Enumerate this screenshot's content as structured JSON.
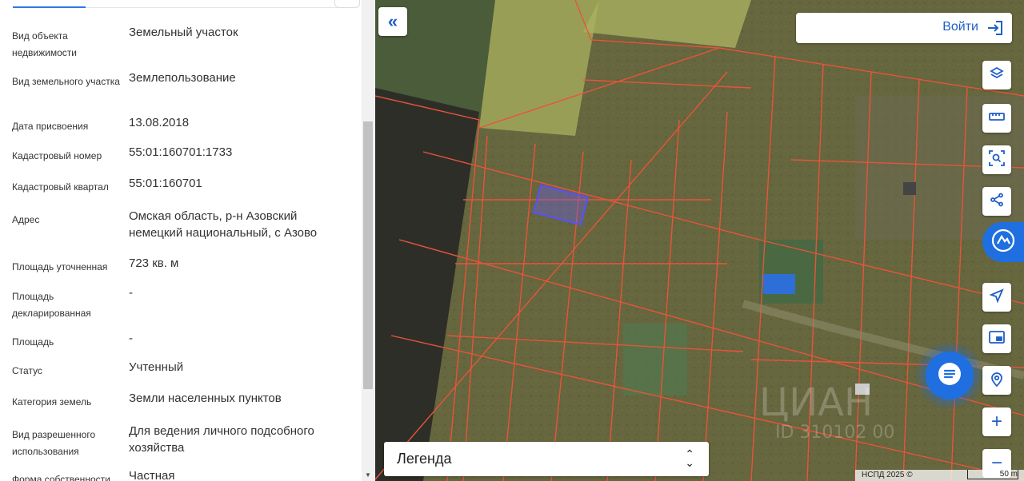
{
  "panel": {
    "rows": [
      {
        "label": "Вид объекта недвижимости",
        "value": "Земельный участок"
      },
      {
        "label": "Вид земельного участка",
        "value": "Землепользование"
      },
      {
        "label": "Дата присвоения",
        "value": "13.08.2018"
      },
      {
        "label": "Кадастровый номер",
        "value": "55:01:160701:1733"
      },
      {
        "label": "Кадастровый квартал",
        "value": "55:01:160701"
      },
      {
        "label": "Адрес",
        "value": "Омская область, р-н Азовский немецкий национальный, с Азово"
      },
      {
        "label": "Площадь уточненная",
        "value": "723 кв. м"
      },
      {
        "label": "Площадь декларированная",
        "value": "-"
      },
      {
        "label": "Площадь",
        "value": "-"
      },
      {
        "label": "Статус",
        "value": "Учтенный"
      },
      {
        "label": "Категория земель",
        "value": "Земли населенных пунктов"
      },
      {
        "label": "Вид разрешенного использования",
        "value": "Для ведения личного подсобного хозяйства"
      },
      {
        "label": "Форма собственности",
        "value": "Частная"
      }
    ]
  },
  "map": {
    "login_label": "Войти",
    "legend_label": "Легенда",
    "attribution": "НСПД 2025 ©",
    "scale_label": "50 m",
    "watermark": "ЦИАН",
    "watermark_id": "ID 310102 00",
    "toolbar_icons": [
      "layers-icon",
      "ruler-icon",
      "area-search-icon",
      "share-icon",
      "navigate-icon",
      "picture-in-picture-icon",
      "location-search-icon",
      "zoom-in-icon",
      "zoom-out-icon"
    ],
    "colors": {
      "accent": "#1f6fe0",
      "parcel_border": "#e8543a",
      "selected_parcel": "#5b4fff"
    }
  }
}
